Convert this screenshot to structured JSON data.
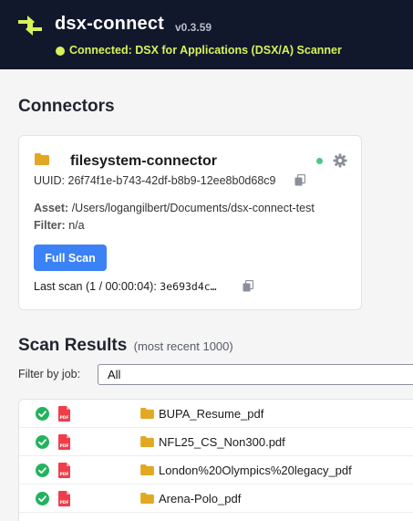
{
  "header": {
    "title": "dsx-connect",
    "version": "v0.3.59",
    "status": "Connected: DSX for Applications (DSX/A) Scanner",
    "colors": {
      "background": "#12182b",
      "status": "#d7f25a"
    }
  },
  "connectors": {
    "title": "Connectors",
    "items": [
      {
        "name": "filesystem-connector",
        "uuid_label": "UUID: ",
        "uuid": "26f74f1e-b743-42df-b8b9-12ee8b0d68c9",
        "asset_label": "Asset:",
        "asset": "/Users/logangilbert/Documents/dsx-connect-test",
        "filter_label": "Filter:",
        "filter": "n/a",
        "scan_button": "Full Scan",
        "last_scan_label": "Last scan (1 / 00:00:04):",
        "last_scan_id": "3e693d4c…",
        "status_color": "#4cc78a",
        "icons": [
          "folder-icon",
          "gear-icon",
          "copy-icon"
        ]
      }
    ]
  },
  "results": {
    "title": "Scan Results",
    "subtitle": "(most recent 1000)",
    "filter_label": "Filter by job:",
    "filter_value": "All",
    "rows": [
      {
        "status": "check-circle-icon",
        "type": "pdf-icon",
        "name": "BUPA_Resume_pdf"
      },
      {
        "status": "check-circle-icon",
        "type": "pdf-icon",
        "name": "NFL25_CS_Non300.pdf"
      },
      {
        "status": "check-circle-icon",
        "type": "pdf-icon",
        "name": "London%20Olympics%20legacy_pdf"
      },
      {
        "status": "check-circle-icon",
        "type": "pdf-icon",
        "name": "Arena-Polo_pdf"
      }
    ]
  }
}
